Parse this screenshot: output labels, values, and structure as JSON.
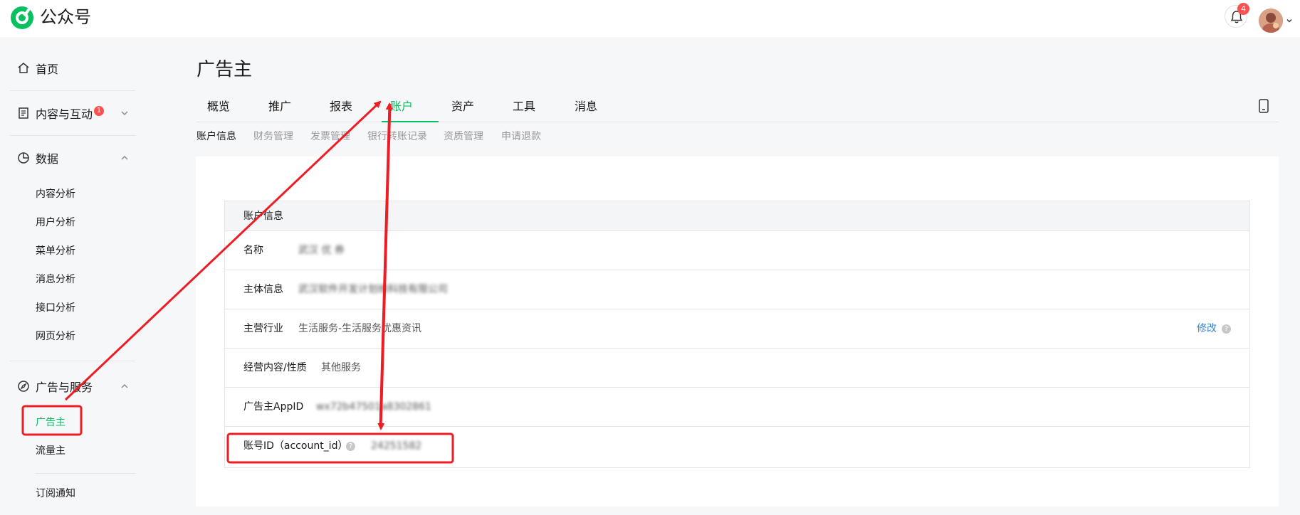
{
  "app": {
    "brand": "公众号"
  },
  "header": {
    "notification_count": "4"
  },
  "sidebar": {
    "home": "首页",
    "content": "内容与互动",
    "content_badge": "1",
    "data": "数据",
    "data_items": [
      "内容分析",
      "用户分析",
      "菜单分析",
      "消息分析",
      "接口分析",
      "网页分析"
    ],
    "ads": "广告与服务",
    "ads_items": [
      "广告主",
      "流量主"
    ],
    "subscribe": "订阅通知"
  },
  "main": {
    "title": "广告主",
    "tabs": [
      "概览",
      "推广",
      "报表",
      "账户",
      "资产",
      "工具",
      "消息"
    ],
    "active_tab": "账户",
    "subtabs": [
      "账户信息",
      "财务管理",
      "发票管理",
      "银行转账记录",
      "资质管理",
      "申请退款"
    ],
    "active_subtab": "账户信息",
    "table": {
      "header": "账户信息",
      "rows": [
        {
          "label": "名称",
          "value": "武汉 优 券"
        },
        {
          "label": "主体信息",
          "value": "武汉软件开发计划维科技有限公司"
        },
        {
          "label": "主营行业",
          "value": "生活服务-生活服务优惠资讯",
          "edit": "修改"
        },
        {
          "label": "经营内容/性质",
          "value": "其他服务"
        },
        {
          "label": "广告主AppID",
          "value": "wx72b47501a8302861"
        },
        {
          "label": "账号ID（account_id）",
          "value": "24251582"
        }
      ]
    }
  },
  "colors": {
    "accent": "#07c160",
    "highlight": "#ee1c24",
    "link": "#2e84d7",
    "badge": "#fa5151"
  }
}
